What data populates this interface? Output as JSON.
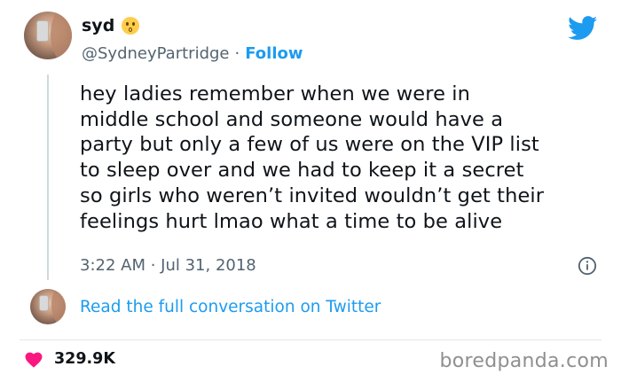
{
  "user": {
    "display_name": "syd",
    "handle": "@SydneyPartridge",
    "separator": "·",
    "follow_label": "Follow",
    "name_emoji": "kissing-face-emoji"
  },
  "tweet": {
    "lines": [
      "hey ladies remember when we were in",
      "middle school and someone would have a",
      "party but only a few of us were on the VIP list",
      "to sleep over and we had to keep it a secret",
      "so girls who weren’t invited wouldn’t get their",
      "feelings hurt lmao what a time to be alive"
    ],
    "timestamp": "3:22 AM · Jul 31, 2018"
  },
  "conversation_link": "Read the full conversation on Twitter",
  "likes": {
    "count": "329.9K"
  },
  "watermark": "boredpanda.com",
  "icons": {
    "brand": "twitter-bird-icon",
    "info": "info-icon",
    "like": "heart-icon"
  },
  "colors": {
    "twitter_blue": "#1d9bf0",
    "text": "#0f1419",
    "secondary_text": "#536471",
    "heart": "#f91880",
    "watermark": "#8f8f8f"
  }
}
